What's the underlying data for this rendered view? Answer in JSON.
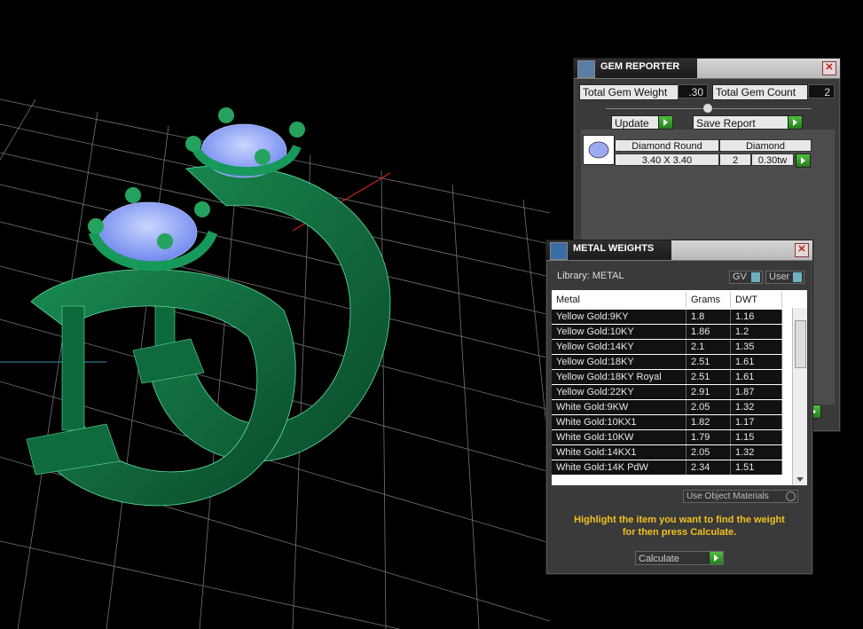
{
  "gem_reporter": {
    "title": "GEM REPORTER",
    "total_weight_label": "Total Gem Weight",
    "total_weight_value": ".30",
    "total_count_label": "Total Gem Count",
    "total_count_value": "2",
    "update_label": "Update",
    "save_report_label": "Save Report",
    "gem_row": {
      "name": "Diamond Round",
      "type": "Diamond",
      "size": "3.40 X 3.40",
      "count": "2",
      "weight": "0.30tw"
    }
  },
  "metal_weights": {
    "title": "METAL WEIGHTS",
    "library_label": "Library: METAL",
    "gv_label": "GV",
    "user_label": "User",
    "columns": [
      "Metal",
      "Grams",
      "DWT"
    ],
    "rows": [
      [
        "Yellow Gold:9KY",
        "1.8",
        "1.16"
      ],
      [
        "Yellow Gold:10KY",
        "1.86",
        "1.2"
      ],
      [
        "Yellow Gold:14KY",
        "2.1",
        "1.35"
      ],
      [
        "Yellow Gold:18KY",
        "2.51",
        "1.61"
      ],
      [
        "Yellow Gold:18KY Royal",
        "2.51",
        "1.61"
      ],
      [
        "Yellow Gold:22KY",
        "2.91",
        "1.87"
      ],
      [
        "White Gold:9KW",
        "2.05",
        "1.32"
      ],
      [
        "White Gold:10KX1",
        "1.82",
        "1.17"
      ],
      [
        "White Gold:10KW",
        "1.79",
        "1.15"
      ],
      [
        "White Gold:14KX1",
        "2.05",
        "1.32"
      ],
      [
        "White Gold:14K PdW",
        "2.34",
        "1.51"
      ]
    ],
    "use_object_materials_label": "Use Object Materials",
    "hint_line1": "Highlight the item you want to find the weight",
    "hint_line2": "for then press Calculate.",
    "calculate_label": "Calculate"
  },
  "colors": {
    "ring_green": "#0f6b3e",
    "gem_blue": "#8fa6f5",
    "hint_yellow": "#f0c020",
    "go_green": "#37a42c"
  },
  "icons": [
    "gem-reporter-icon",
    "metal-weights-icon",
    "close-icon",
    "go-arrow-icon",
    "gem-thumbnail-icon",
    "slider-knob-icon"
  ]
}
